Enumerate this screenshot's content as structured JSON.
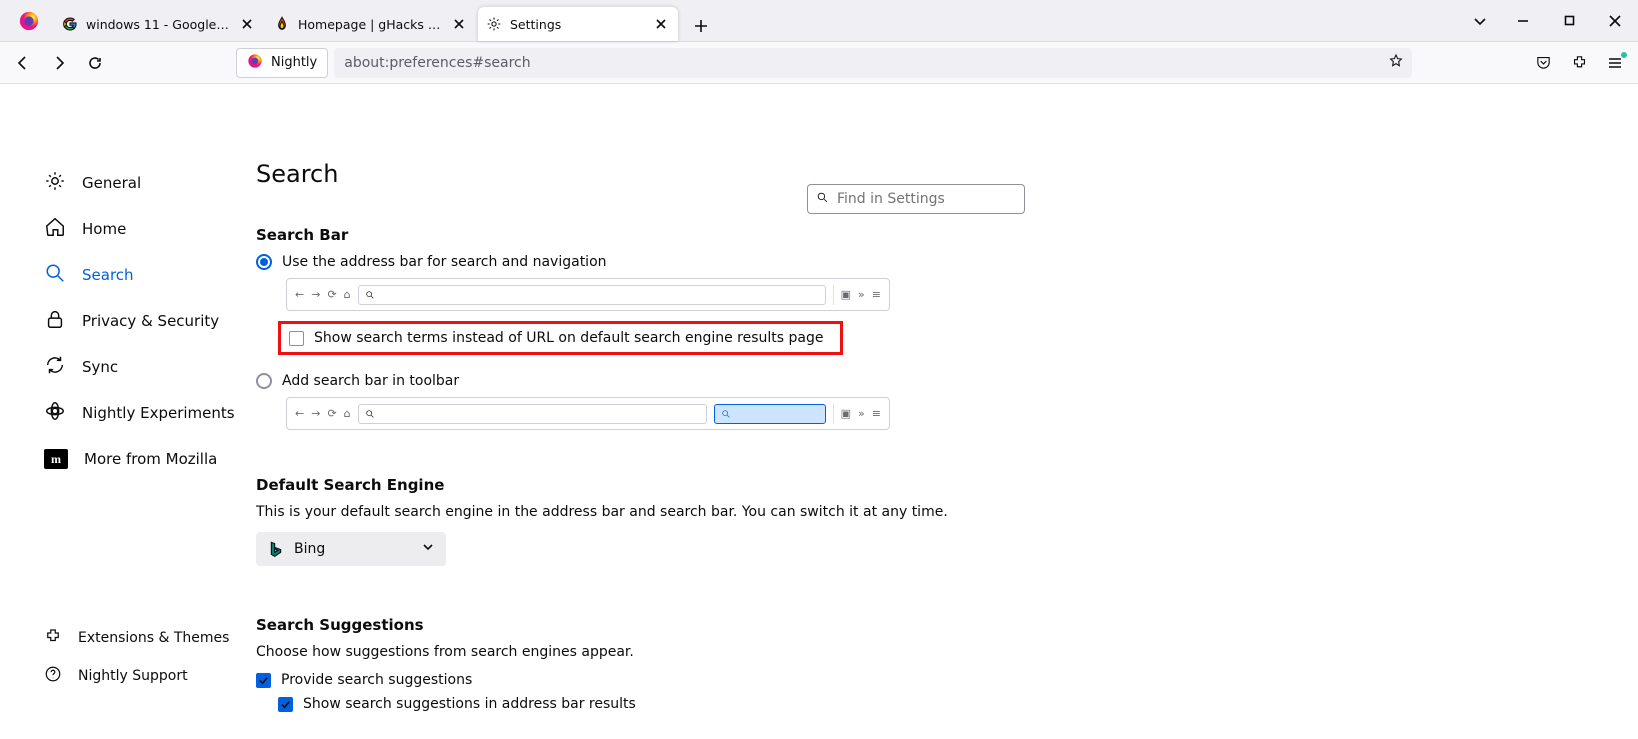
{
  "tabs": [
    {
      "title": "windows 11 - Google Search"
    },
    {
      "title": "Homepage | gHacks Technolog"
    },
    {
      "title": "Settings"
    }
  ],
  "identity_label": "Nightly",
  "url_value": "about:preferences#search",
  "search_settings_placeholder": "Find in Settings",
  "sidebar": {
    "items": [
      "General",
      "Home",
      "Search",
      "Privacy & Security",
      "Sync",
      "Nightly Experiments",
      "More from Mozilla"
    ],
    "bottom": [
      "Extensions & Themes",
      "Nightly Support"
    ]
  },
  "page": {
    "h1": "Search",
    "sec1": "Search Bar",
    "radio1": "Use the address bar for search and navigation",
    "check1": "Show search terms instead of URL on default search engine results page",
    "radio2": "Add search bar in toolbar",
    "sec2": "Default Search Engine",
    "desc2": "This is your default search engine in the address bar and search bar. You can switch it at any time.",
    "engine": "Bing",
    "sec3": "Search Suggestions",
    "desc3": "Choose how suggestions from search engines appear.",
    "check2": "Provide search suggestions",
    "check3": "Show search suggestions in address bar results"
  }
}
